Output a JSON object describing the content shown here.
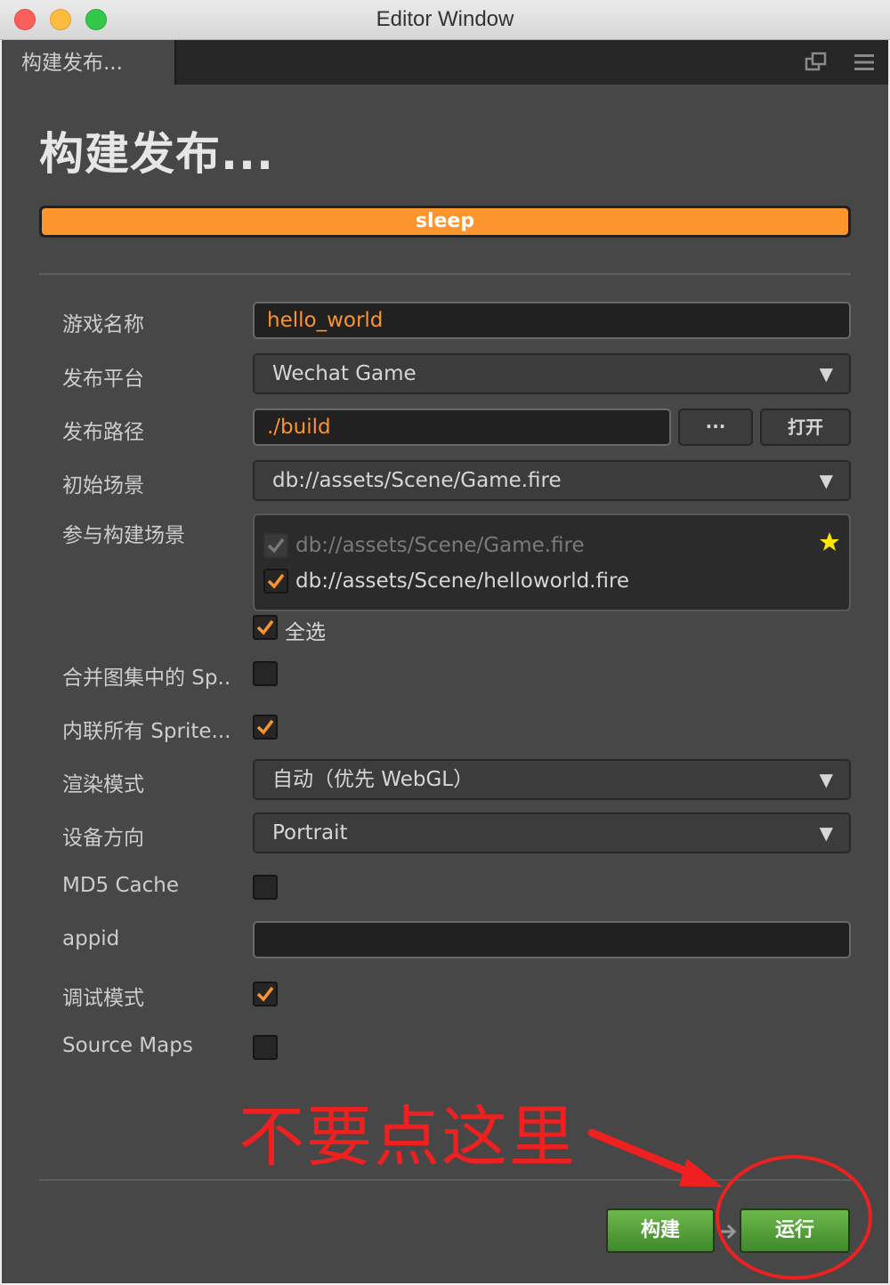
{
  "window": {
    "title": "Editor Window"
  },
  "tab": {
    "label": "构建发布..."
  },
  "page": {
    "title": "构建发布..."
  },
  "progress": {
    "text": "sleep",
    "value_percent": 100,
    "color": "#fc952e"
  },
  "form": {
    "game_name": {
      "label": "游戏名称",
      "value": "hello_world"
    },
    "platform": {
      "label": "发布平台",
      "value": "Wechat Game"
    },
    "build_path": {
      "label": "发布路径",
      "value": "./build",
      "browse_label": "···",
      "open_label": "打开"
    },
    "start_scene": {
      "label": "初始场景",
      "value": "db://assets/Scene/Game.fire"
    },
    "included_scenes": {
      "label": "参与构建场景",
      "items": [
        {
          "path": "db://assets/Scene/Game.fire",
          "checked": true,
          "disabled": true,
          "starred": true
        },
        {
          "path": "db://assets/Scene/helloworld.fire",
          "checked": true,
          "disabled": false,
          "starred": false
        }
      ],
      "select_all_label": "全选",
      "select_all_checked": true
    },
    "merge_atlas": {
      "label": "合并图集中的 Sp..",
      "checked": false
    },
    "inline_sprite": {
      "label": "内联所有 Sprite...",
      "checked": true
    },
    "render_mode": {
      "label": "渲染模式",
      "value": "自动（优先 WebGL）"
    },
    "orientation": {
      "label": "设备方向",
      "value": "Portrait"
    },
    "md5_cache": {
      "label": "MD5 Cache",
      "checked": false
    },
    "appid": {
      "label": "appid",
      "value": ""
    },
    "debug_mode": {
      "label": "调试模式",
      "checked": true
    },
    "source_maps": {
      "label": "Source Maps",
      "checked": false
    }
  },
  "annotation": {
    "text": "不要点这里",
    "color": "#ee2020"
  },
  "actions": {
    "build_label": "构建",
    "run_label": "运行"
  },
  "colors": {
    "accent": "#fd942b",
    "panel": "#474747",
    "green": "#4f9a35"
  }
}
